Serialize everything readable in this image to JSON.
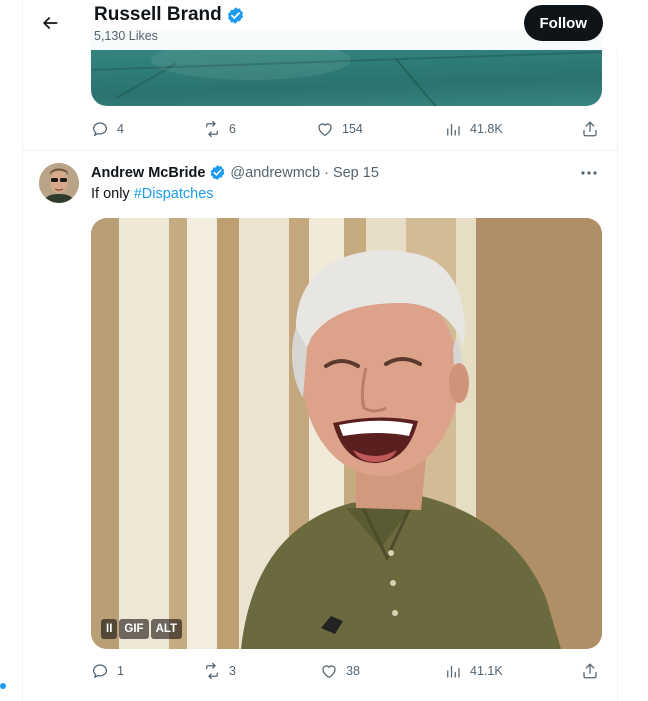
{
  "header": {
    "name": "Russell Brand",
    "likes": "5,130 Likes",
    "follow_label": "Follow"
  },
  "tweet1": {
    "actions": {
      "replies": "4",
      "retweets": "6",
      "likes": "154",
      "views": "41.8K"
    }
  },
  "tweet2": {
    "name": "Andrew McBride",
    "handle": "@andrewmcb",
    "separator": "·",
    "date": "Sep 15",
    "text": "If only",
    "hashtag": "#Dispatches",
    "media_badges": {
      "pause": "II",
      "gif": "GIF",
      "alt": "ALT"
    },
    "actions": {
      "replies": "1",
      "retweets": "3",
      "likes": "38",
      "views": "41.1K"
    }
  },
  "colors": {
    "accent": "#1d9bf0",
    "text": "#0f1419",
    "muted": "#536471",
    "follow_bg": "#0f1419"
  },
  "icons": [
    "back-arrow-icon",
    "verified-badge-icon",
    "reply-icon",
    "retweet-icon",
    "like-icon",
    "views-icon",
    "share-icon",
    "more-icon"
  ]
}
